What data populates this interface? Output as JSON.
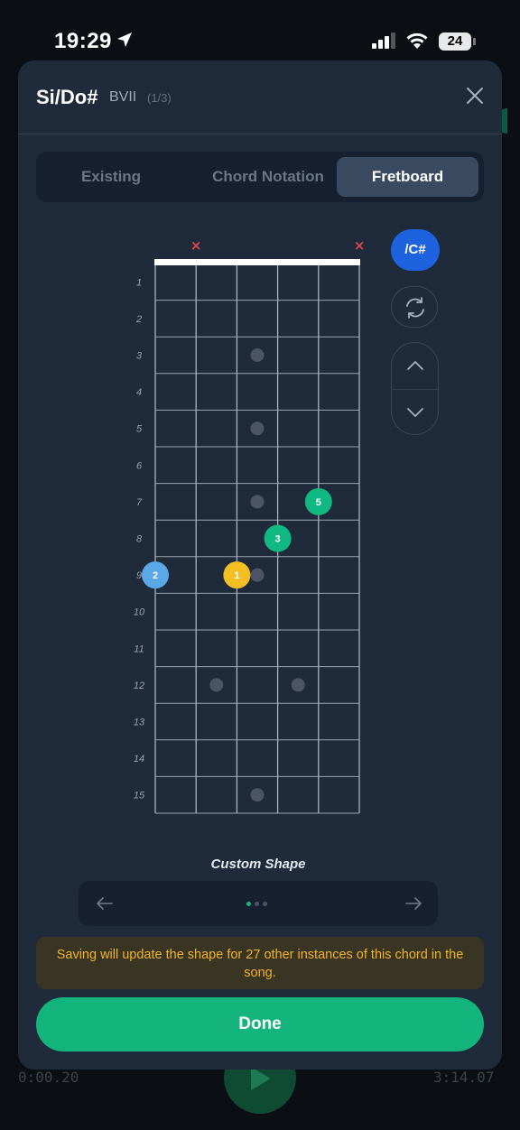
{
  "status_bar": {
    "time": "19:29",
    "battery": "24"
  },
  "background": {
    "elapsed": "0:00.20",
    "total": "3:14.07"
  },
  "modal": {
    "title": "Si/Do#",
    "degree": "BVII",
    "count": "(1/3)"
  },
  "tabs": [
    {
      "label": "Existing",
      "active": false
    },
    {
      "label": "Chord Notation",
      "active": false
    },
    {
      "label": "Fretboard",
      "active": true
    }
  ],
  "fretboard": {
    "strings": 6,
    "frets": 15,
    "fret_numbers": [
      "1",
      "2",
      "3",
      "4",
      "5",
      "6",
      "7",
      "8",
      "9",
      "10",
      "11",
      "12",
      "13",
      "14",
      "15"
    ],
    "muted_strings": [
      2,
      6
    ],
    "inlay_markers": [
      {
        "fret": 3,
        "between": [
          3,
          4
        ]
      },
      {
        "fret": 5,
        "between": [
          3,
          4
        ]
      },
      {
        "fret": 7,
        "between": [
          3,
          4
        ]
      },
      {
        "fret": 9,
        "between": [
          3,
          4
        ]
      },
      {
        "fret": 12,
        "between": [
          2,
          3
        ]
      },
      {
        "fret": 12,
        "between": [
          4,
          5
        ]
      },
      {
        "fret": 15,
        "between": [
          3,
          4
        ]
      }
    ],
    "fingers": [
      {
        "finger": "2",
        "string": 1,
        "fret": 9,
        "color": "#5aa9e6"
      },
      {
        "finger": "1",
        "string": 3,
        "fret": 9,
        "color": "#f4bf22"
      },
      {
        "finger": "3",
        "string": 4,
        "fret": 8,
        "color": "#10b981"
      },
      {
        "finger": "5",
        "string": 5,
        "fret": 7,
        "color": "#10b981"
      }
    ],
    "mute_symbol": "×"
  },
  "controls": {
    "slash_label": "/C#",
    "swap_icon": "swap-icon",
    "up_icon": "chevron-up-icon",
    "down_icon": "chevron-down-icon"
  },
  "shape": {
    "label": "Custom Shape",
    "pages": 3,
    "current_page": 1
  },
  "notice": "Saving will update the shape for 27 other instances of this chord in the song.",
  "done_label": "Done",
  "colors": {
    "accent": "#13b57d",
    "slash": "#1d63e0",
    "warning": "#f0b323",
    "mute": "#e0464e"
  }
}
